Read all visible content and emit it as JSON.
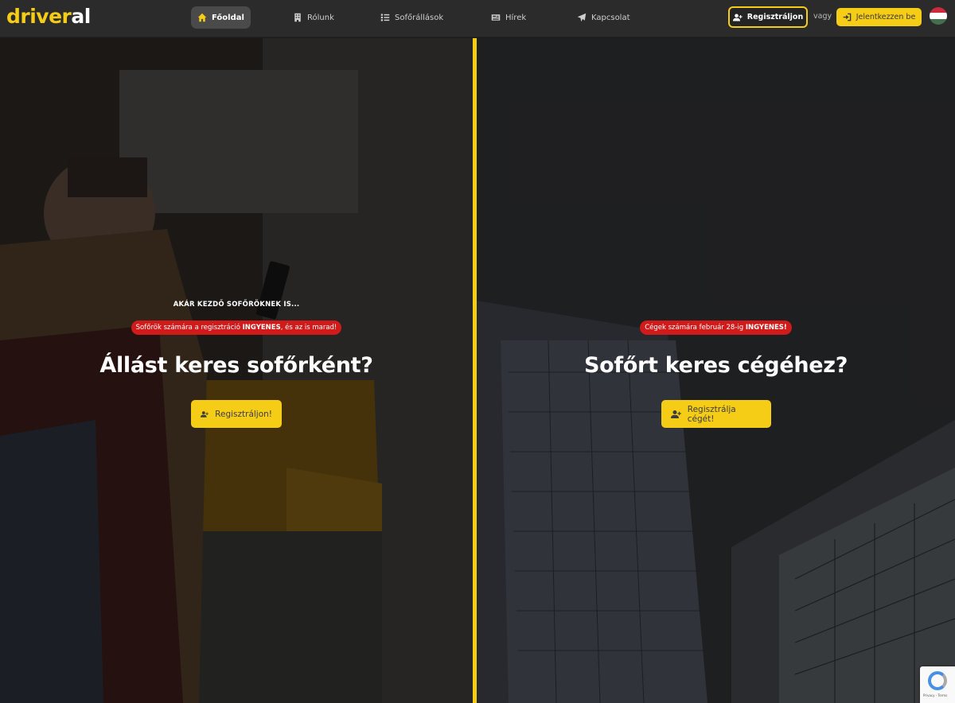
{
  "brand": {
    "part1": "driver",
    "part2": "al"
  },
  "nav": {
    "items": [
      {
        "label": "Főoldal",
        "icon": "home-icon",
        "active": true
      },
      {
        "label": "Rólunk",
        "icon": "building-icon",
        "active": false
      },
      {
        "label": "Sofőrállások",
        "icon": "list-icon",
        "active": false
      },
      {
        "label": "Hírek",
        "icon": "newspaper-icon",
        "active": false
      },
      {
        "label": "Kapcsolat",
        "icon": "paper-plane-icon",
        "active": false
      }
    ],
    "register_label": "Regisztráljon",
    "or_label": "vagy",
    "login_label": "Jelentkezzen be",
    "language_flag": "hungary-flag-icon"
  },
  "hero": {
    "left": {
      "eyebrow": "AKÁR KEZDŐ SOFŐRÖKNEK IS...",
      "pill_before": "Sofőrök számára a regisztráció ",
      "pill_bold": "INGYENES",
      "pill_after": ", és az is marad!",
      "heading": "Állást keres sofőrként?",
      "cta": "Regisztráljon!"
    },
    "right": {
      "pill_before": "Cégek számára február 28-ig ",
      "pill_bold": "INGYENES!",
      "heading": "Sofőrt keres cégéhez?",
      "cta": "Regisztrálja cégét!"
    }
  },
  "colors": {
    "accent": "#f5cc16",
    "danger": "#d11a1a",
    "nav_bg": "#2b2b2b"
  },
  "recaptcha": {
    "text": "Privacy - Terms"
  }
}
